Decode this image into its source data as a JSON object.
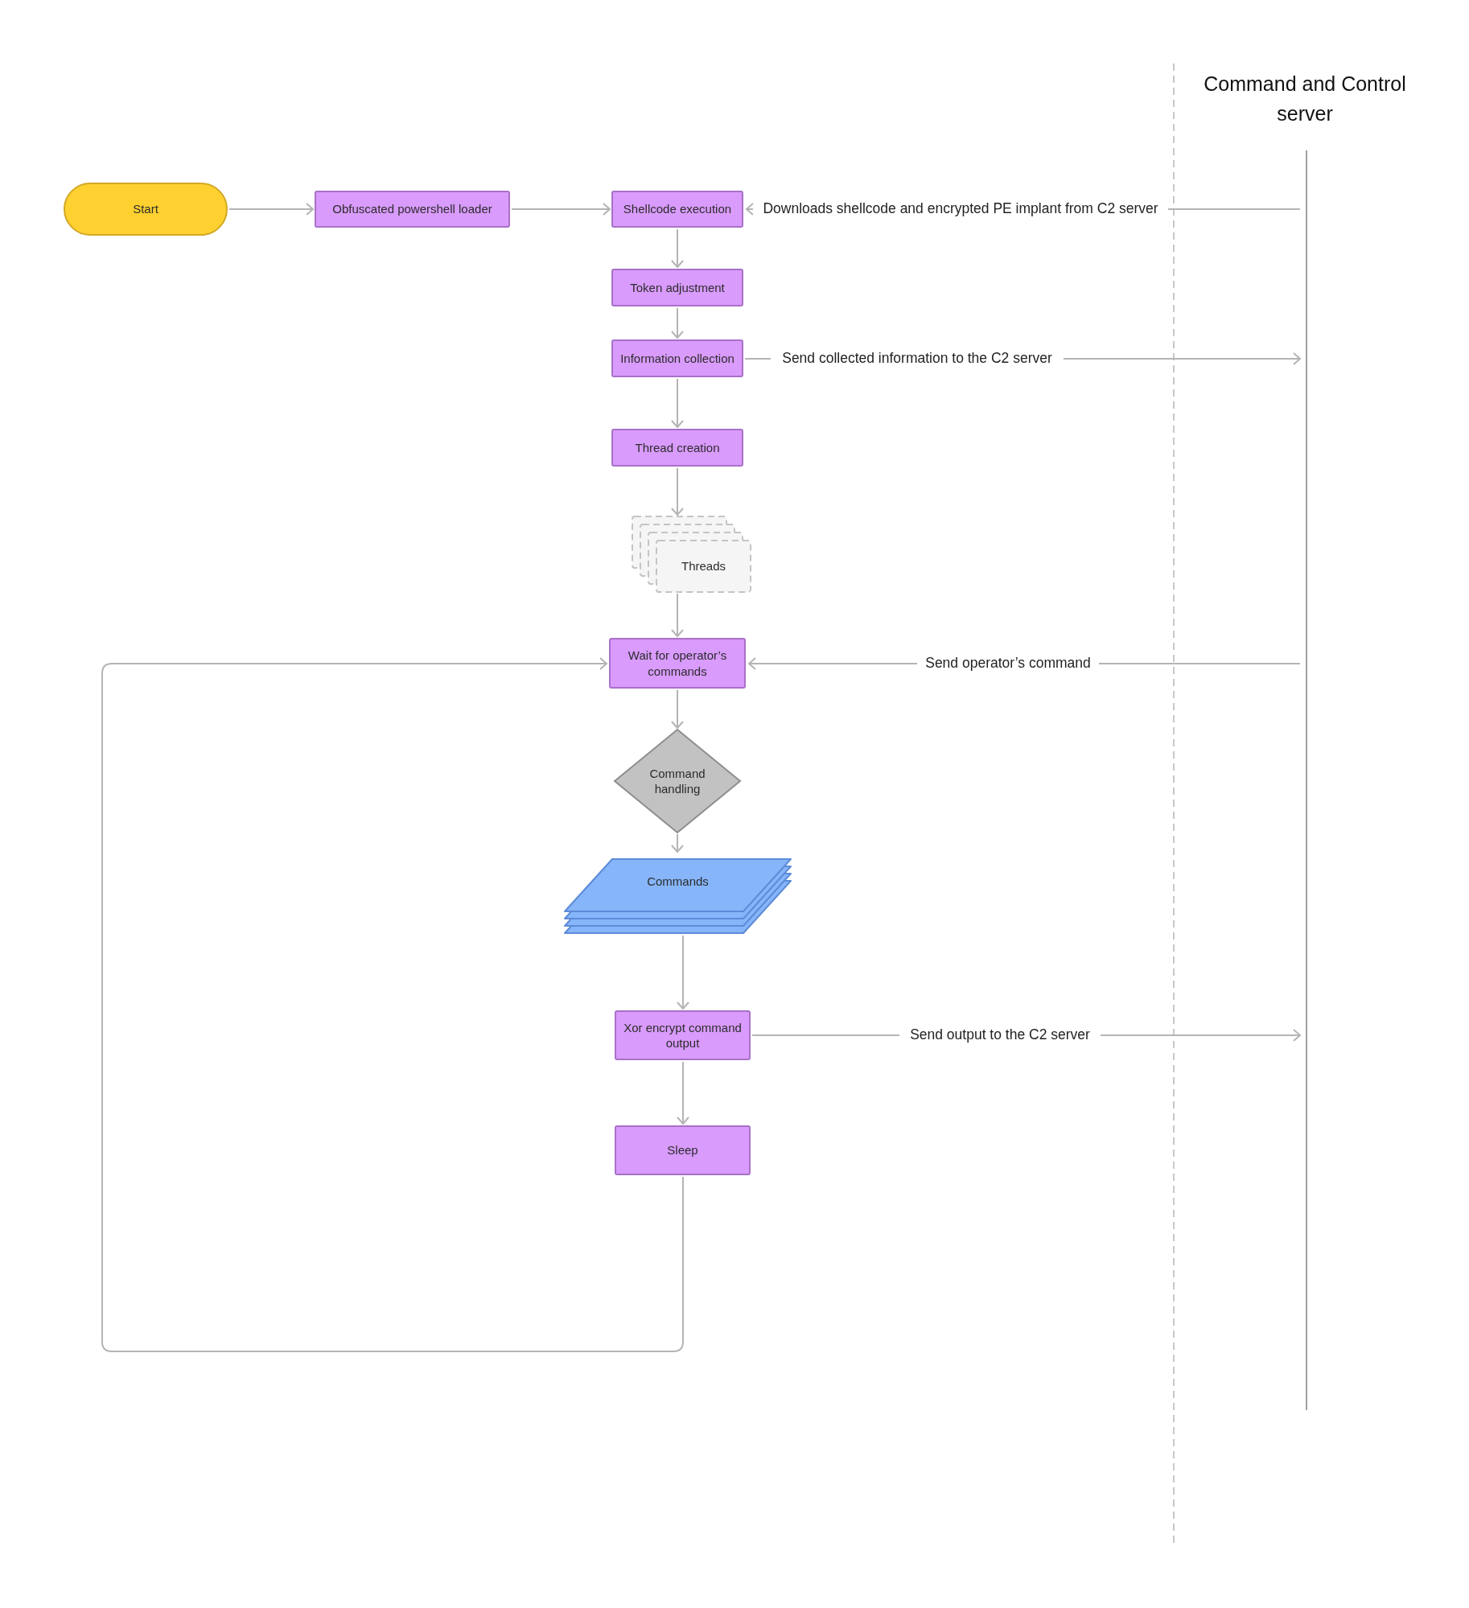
{
  "lane": {
    "title": "Command and Control server"
  },
  "nodes": [
    {
      "kind": "terminal",
      "label": "Start"
    },
    {
      "kind": "process",
      "label": "Obfuscated powershell loader"
    },
    {
      "kind": "process",
      "label": "Shellcode execution"
    },
    {
      "kind": "process",
      "label": "Token adjustment"
    },
    {
      "kind": "process",
      "label": "Information collection"
    },
    {
      "kind": "process",
      "label": "Thread creation"
    },
    {
      "kind": "stack",
      "label": "Threads"
    },
    {
      "kind": "process",
      "label": "Wait for operator’s commands"
    },
    {
      "kind": "decision",
      "label": "Command handling"
    },
    {
      "kind": "data",
      "label": "Commands"
    },
    {
      "kind": "process",
      "label": "Xor encrypt command output"
    },
    {
      "kind": "process",
      "label": "Sleep"
    }
  ],
  "messages": [
    {
      "kind": "incoming",
      "label": "Downloads shellcode and encrypted PE implant from C2 server"
    },
    {
      "kind": "outgoing",
      "label": "Send collected information to the C2 server"
    },
    {
      "kind": "incoming",
      "label": "Send operator’s command"
    },
    {
      "kind": "outgoing",
      "label": "Send output to the C2 server"
    }
  ]
}
